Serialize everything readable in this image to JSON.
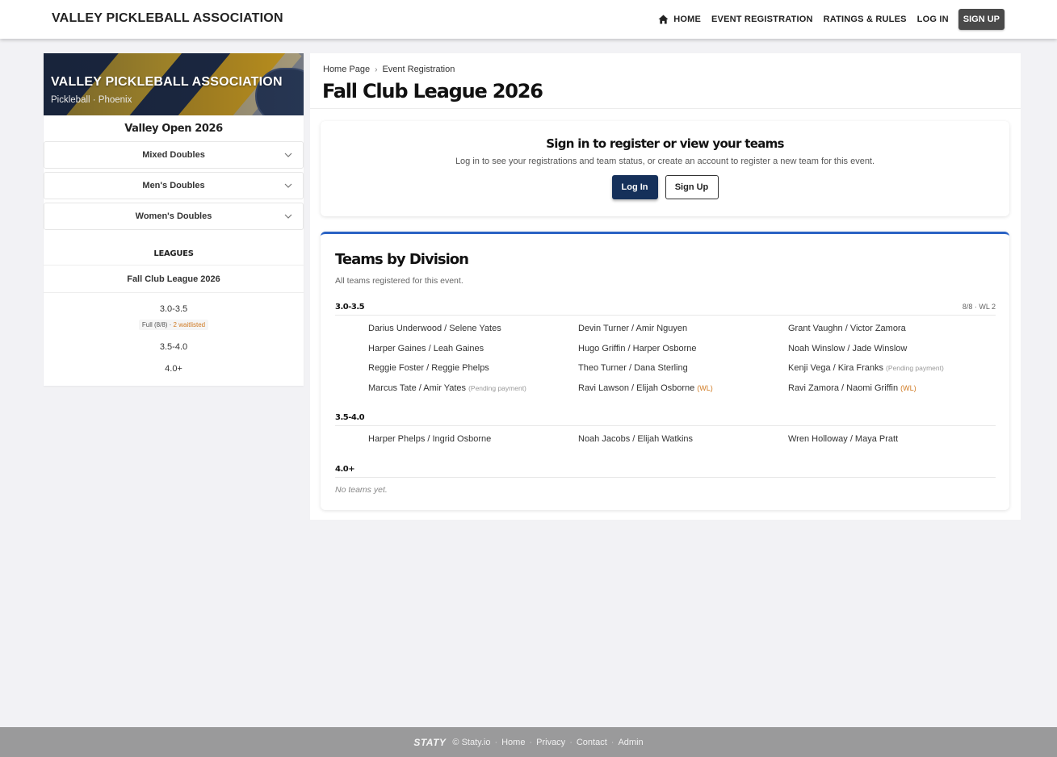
{
  "header": {
    "brand": "VALLEY PICKLEBALL ASSOCIATION",
    "nav": {
      "home": "HOME",
      "event_registration": "EVENT REGISTRATION",
      "ratings_rules": "RATINGS & RULES",
      "login": "LOG IN",
      "signup": "SIGN UP"
    }
  },
  "sidebar": {
    "banner_title": "VALLEY PICKLEBALL ASSOCIATION",
    "banner_subtitle": "Pickleball · Phoenix",
    "event_name": "Valley Open 2026",
    "accordions": [
      "Mixed Doubles",
      "Men's Doubles",
      "Women's Doubles"
    ],
    "leagues_title": "LEAGUES",
    "league_name": "Fall Club League 2026",
    "divisions": [
      {
        "name": "3.0-3.5",
        "status": "Full (8/8)",
        "sep": " · ",
        "waitlist": "2 waitlisted"
      },
      {
        "name": "3.5-4.0"
      },
      {
        "name": "4.0+"
      }
    ]
  },
  "main": {
    "breadcrumb": {
      "home": "Home Page",
      "sep": "›",
      "current": "Event Registration"
    },
    "title": "Fall Club League 2026",
    "signin": {
      "title": "Sign in to register or view your teams",
      "description": "Log in to see your registrations and team status, or create an account to register a new team for this event.",
      "login_button": "Log In",
      "signup_button": "Sign Up"
    },
    "teams": {
      "title": "Teams by Division",
      "subtitle": "All teams registered for this event.",
      "divisions": [
        {
          "name": "3.0-3.5",
          "count": "8/8 · WL 2",
          "teams": [
            {
              "name": "Darius Underwood / Selene Yates",
              "note": "",
              "wl": ""
            },
            {
              "name": "Devin Turner / Amir Nguyen",
              "note": "",
              "wl": ""
            },
            {
              "name": "Grant Vaughn / Victor Zamora",
              "note": "",
              "wl": ""
            },
            {
              "name": "Harper Gaines / Leah Gaines",
              "note": "",
              "wl": ""
            },
            {
              "name": "Hugo Griffin / Harper Osborne",
              "note": "",
              "wl": ""
            },
            {
              "name": "Noah Winslow / Jade Winslow",
              "note": "",
              "wl": ""
            },
            {
              "name": "Reggie Foster / Reggie Phelps",
              "note": "",
              "wl": ""
            },
            {
              "name": "Theo Turner / Dana Sterling",
              "note": "",
              "wl": ""
            },
            {
              "name": "Kenji Vega / Kira Franks",
              "note": "(Pending payment)",
              "wl": ""
            },
            {
              "name": "Marcus Tate / Amir Yates",
              "note": "(Pending payment)",
              "wl": ""
            },
            {
              "name": "Ravi Lawson / Elijah Osborne",
              "note": "",
              "wl": "(WL)"
            },
            {
              "name": "Ravi Zamora / Naomi Griffin",
              "note": "",
              "wl": "(WL)"
            }
          ]
        },
        {
          "name": "3.5-4.0",
          "count": "",
          "teams": [
            {
              "name": "Harper Phelps / Ingrid Osborne",
              "note": "",
              "wl": ""
            },
            {
              "name": "Noah Jacobs / Elijah Watkins",
              "note": "",
              "wl": ""
            },
            {
              "name": "Wren Holloway / Maya Pratt",
              "note": "",
              "wl": ""
            }
          ]
        },
        {
          "name": "4.0+",
          "count": "",
          "empty_text": "No teams yet."
        }
      ]
    }
  },
  "footer": {
    "logo": "STATY",
    "copyright": "© Staty.io",
    "links": [
      "Home",
      "Privacy",
      "Contact",
      "Admin"
    ],
    "sep": "·"
  }
}
